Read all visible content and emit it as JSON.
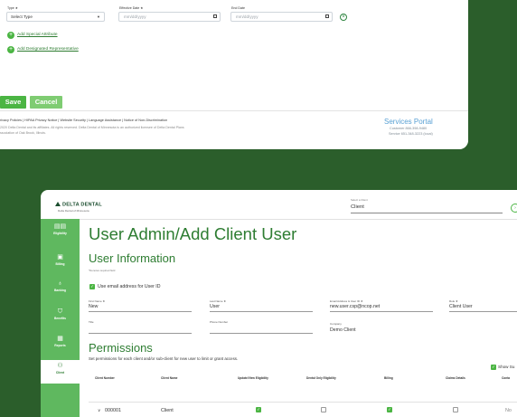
{
  "upper_form": {
    "type_label": "Type ★",
    "type_value": "Select Type",
    "effective_date_label": "Effective Date ★",
    "effective_date_placeholder": "mm/dd/yyyy",
    "end_date_label": "End Date",
    "end_date_placeholder": "mm/dd/yyyy",
    "add_special_attribute": "Add Special Attribute",
    "add_designated_representative": "Add Designated Representative",
    "save_label": "Save",
    "cancel_label": "Cancel"
  },
  "footer": {
    "links": "rivacy Policies | HIPAA Privacy Notice | Website Security | Language Assistance | Notice of Non-Discrimination",
    "copyright_line1": "2020 Delta Dental and its affiliates. All rights reserved. Delta Dental of Minnesota is an authorized licensee of Delta Dental Plans",
    "copyright_line2": "ssociation of Oak Brook, Illinois.",
    "services_portal": "Services Portal",
    "customer_line": "Customer  866-398-9480",
    "service_line": "Service 651-348-3223 (local)"
  },
  "header": {
    "brand": "DELTA DENTAL",
    "brand_sub": "Delta Dental of Minnesota",
    "client_select_label": "Select a Client",
    "client_select_value": "Client"
  },
  "sidebar": {
    "items": [
      {
        "label": "Eligibility",
        "icon": "id-card-icon"
      },
      {
        "label": "Billing",
        "icon": "dollar-doc-icon"
      },
      {
        "label": "Banking",
        "icon": "money-bag-icon"
      },
      {
        "label": "Benefits",
        "icon": "shield-icon"
      },
      {
        "label": "Reports",
        "icon": "report-icon"
      },
      {
        "label": "Client",
        "icon": "people-icon"
      }
    ]
  },
  "page": {
    "title": "User Admin/Add Client User",
    "section_title": "User Information",
    "required_note": "*Denotes required field",
    "use_email_label": "Use email address for User ID"
  },
  "fields": {
    "first_name_label": "First Name ★",
    "first_name_value": "New",
    "last_name_label": "Last Name ★",
    "last_name_value": "User",
    "email_label": "Email Address & User ID ★",
    "email_value": "new.user.csp@ncop.net",
    "role_label": "Role ★",
    "role_value": "Client User",
    "title_label": "Title",
    "phone_label": "Phone Number",
    "company_label": "Company",
    "company_value": "Demo Client"
  },
  "permissions": {
    "title": "Permissions",
    "subtitle": "Set permissions for each client and/or sub-client for new user to limit or grant access.",
    "show_sub_label": "Show Su",
    "columns": [
      "Client Number",
      "Client Name",
      "Update/View Eligibility",
      "Dental Only Eligibility",
      "Billing",
      "Claims Details",
      "Conta"
    ],
    "row": {
      "number": "000001",
      "name": "Client",
      "trailing": "No"
    }
  },
  "colors": {
    "brand_green": "#2e7d32",
    "accent_green": "#4bb543",
    "sidebar_green": "#5fb85f",
    "background": "#2b5e2b",
    "link_blue": "#58a0d4"
  }
}
